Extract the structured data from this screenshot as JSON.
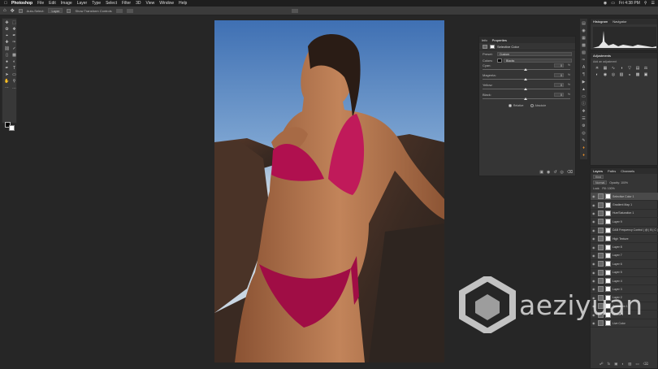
{
  "menubar": {
    "apple": "",
    "app": "Photoshop",
    "items": [
      "File",
      "Edit",
      "Image",
      "Layer",
      "Type",
      "Select",
      "Filter",
      "3D",
      "View",
      "Window",
      "Help"
    ],
    "clock": "Fri 4:38 PM"
  },
  "options": {
    "auto_select": "Auto-Select:",
    "layer_select": "Layer",
    "transform": "Show Transform Controls"
  },
  "properties": {
    "tabs": [
      "Info",
      "Properties"
    ],
    "active_tab": "Properties",
    "title": "Selective Color",
    "preset_label": "Preset:",
    "preset_value": "Custom",
    "colors_label": "Colors:",
    "colors_value": "Blacks",
    "sliders": [
      {
        "label": "Cyan:",
        "value": "0",
        "level": 0.5
      },
      {
        "label": "Magenta:",
        "value": "0",
        "level": 0.5
      },
      {
        "label": "Yellow:",
        "value": "0",
        "level": 0.5
      },
      {
        "label": "Black:",
        "value": "0",
        "level": 0.5
      }
    ],
    "pct": "%",
    "relative": "Relative",
    "absolute": "Absolute"
  },
  "histogram": {
    "tabs": [
      "Histogram",
      "Navigator"
    ],
    "active": "Histogram"
  },
  "adjustments": {
    "title": "Adjustments",
    "sub": "Add an adjustment"
  },
  "layers": {
    "tabs": [
      "Layers",
      "Paths",
      "Channels"
    ],
    "active": "Layers",
    "kind": "Kind",
    "blend": "Normal",
    "opacity": "Opacity: 100%",
    "lock": "Lock:",
    "fill": "Fill: 100%",
    "items": [
      {
        "name": "Selective Color 1",
        "sel": true
      },
      {
        "name": "Gradient Map 1",
        "sel": false
      },
      {
        "name": "Hue/Saturation 1",
        "sel": false
      },
      {
        "name": "Layer 9",
        "sel": false
      },
      {
        "name": "D&B Frequency Control | @ | B | C |",
        "sel": false
      },
      {
        "name": "High Texture",
        "sel": false
      },
      {
        "name": "Layer 8",
        "sel": false
      },
      {
        "name": "Layer 7",
        "sel": false
      },
      {
        "name": "Layer 6",
        "sel": false
      },
      {
        "name": "Layer 5",
        "sel": false
      },
      {
        "name": "Layer 4",
        "sel": false
      },
      {
        "name": "Layer 3",
        "sel": false
      },
      {
        "name": "Layer 2",
        "sel": false
      },
      {
        "name": "Transform 1",
        "sel": false
      },
      {
        "name": "Levels 1",
        "sel": false
      },
      {
        "name": "Live Color",
        "sel": false
      }
    ]
  },
  "watermark": "aeziyuan",
  "colors": {
    "accent": "#e38b2a",
    "bikini": "#b0104f",
    "sky": "#6b95c4"
  }
}
